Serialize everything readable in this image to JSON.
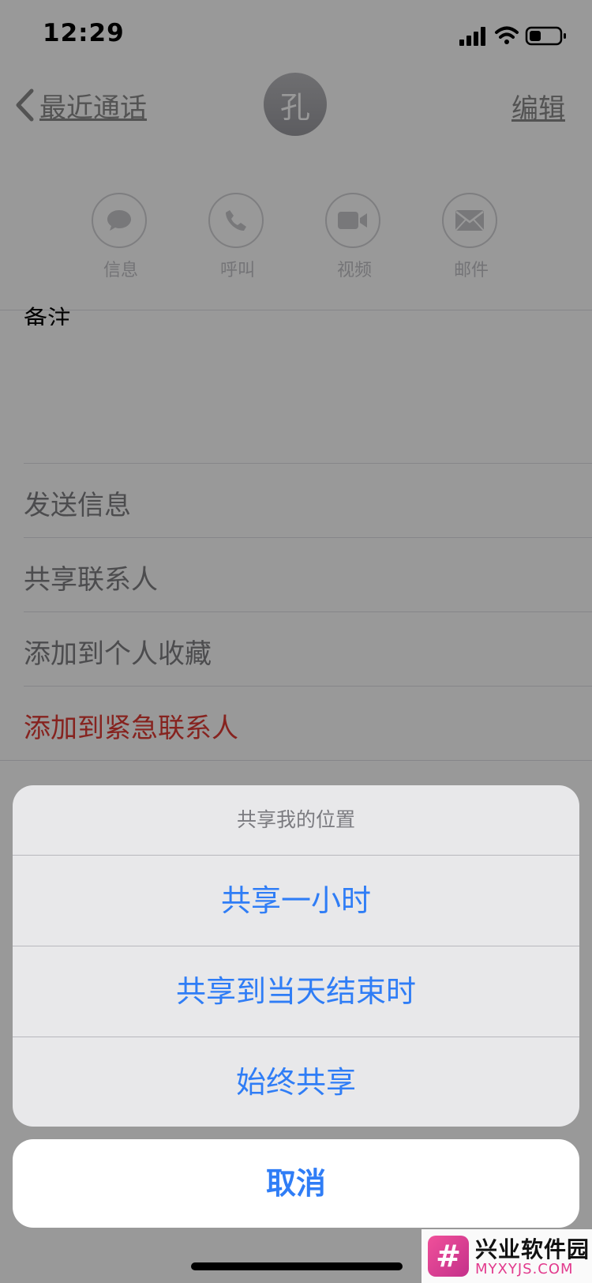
{
  "status_bar": {
    "time": "12:29"
  },
  "nav": {
    "back_label": "最近通话",
    "avatar_initial": "孔",
    "edit_label": "编辑"
  },
  "actions": [
    {
      "label": "信息",
      "icon": "message-bubble-icon"
    },
    {
      "label": "呼叫",
      "icon": "phone-icon"
    },
    {
      "label": "视频",
      "icon": "video-camera-icon"
    },
    {
      "label": "邮件",
      "icon": "mail-icon"
    }
  ],
  "notes": {
    "label": "备注"
  },
  "contact_rows": [
    {
      "label": "发送信息"
    },
    {
      "label": "共享联系人"
    },
    {
      "label": "添加到个人收藏"
    },
    {
      "label": "添加到紧急联系人"
    }
  ],
  "action_sheet": {
    "title": "共享我的位置",
    "options": [
      "共享一小时",
      "共享到当天结束时",
      "始终共享"
    ],
    "cancel_label": "取消"
  },
  "watermark": {
    "logo_glyph": "#",
    "title": "兴业软件园",
    "url": "MYXYJS.COM"
  },
  "colors": {
    "accent": "#2f7df6",
    "danger": "#e03b34",
    "watermark": "#e23a8d"
  }
}
